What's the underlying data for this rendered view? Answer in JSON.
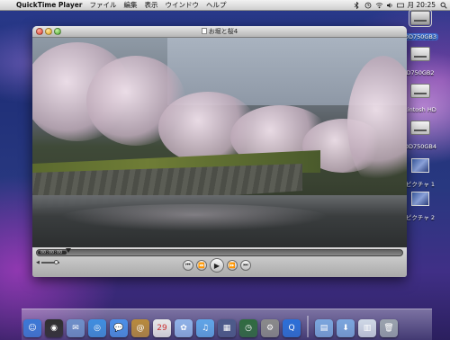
{
  "menubar": {
    "apple_glyph": "",
    "app_name": "QuickTime Player",
    "menus": [
      "ファイル",
      "編集",
      "表示",
      "ウインドウ",
      "ヘルプ"
    ],
    "clock": "月 20:25"
  },
  "desktop_icons": [
    {
      "label": "DD750GB3",
      "kind": "drive",
      "selected": true
    },
    {
      "label": "D750GB2",
      "kind": "drive",
      "selected": false
    },
    {
      "label": "cintosh HD",
      "kind": "drive",
      "selected": false
    },
    {
      "label": "DD750GB4",
      "kind": "drive",
      "selected": false
    },
    {
      "label": "ピクチャ 1",
      "kind": "picture",
      "selected": false
    },
    {
      "label": "ピクチャ 2",
      "kind": "picture",
      "selected": false
    }
  ],
  "window": {
    "title": "お堀と桜4",
    "timecode": "00:00:00",
    "playback_fraction": 0.08,
    "volume_fraction": 0.8,
    "controls": {
      "skip_back": "⏮",
      "rewind": "⏪",
      "play": "▶",
      "fast_forward": "⏩",
      "skip_forward": "⏭"
    }
  },
  "dock": {
    "items": [
      {
        "name": "finder-icon",
        "glyph": "☺",
        "color": "#3a78d6"
      },
      {
        "name": "dashboard-icon",
        "glyph": "◉",
        "color": "#2e2e2e"
      },
      {
        "name": "mail-icon",
        "glyph": "✉",
        "color": "#6d8fc9"
      },
      {
        "name": "safari-icon",
        "glyph": "◎",
        "color": "#3f8ee0"
      },
      {
        "name": "ichat-icon",
        "glyph": "💬",
        "color": "#4b8fe8"
      },
      {
        "name": "address-book-icon",
        "glyph": "@",
        "color": "#b88a3c"
      },
      {
        "name": "ical-icon",
        "glyph": "29",
        "color": "#e8e8e8"
      },
      {
        "name": "iphoto-icon",
        "glyph": "✿",
        "color": "#8fb2e8"
      },
      {
        "name": "itunes-icon",
        "glyph": "♫",
        "color": "#5fa5e8"
      },
      {
        "name": "spaces-icon",
        "glyph": "▦",
        "color": "#4c5a8a"
      },
      {
        "name": "time-machine-icon",
        "glyph": "◷",
        "color": "#2f6b3f"
      },
      {
        "name": "system-preferences-icon",
        "glyph": "⚙",
        "color": "#8a8a8a"
      },
      {
        "name": "quicktime-icon",
        "glyph": "Q",
        "color": "#2b6fd8"
      }
    ],
    "stack_items": [
      {
        "name": "applications-folder-icon",
        "glyph": "▤",
        "color": "#7aa6de"
      },
      {
        "name": "downloads-folder-icon",
        "glyph": "⬇",
        "color": "#7aa6de"
      },
      {
        "name": "documents-stack-icon",
        "glyph": "▥",
        "color": "#cfd8e6"
      },
      {
        "name": "trash-icon",
        "glyph": "🗑",
        "color": "#9aa3ad"
      }
    ]
  }
}
